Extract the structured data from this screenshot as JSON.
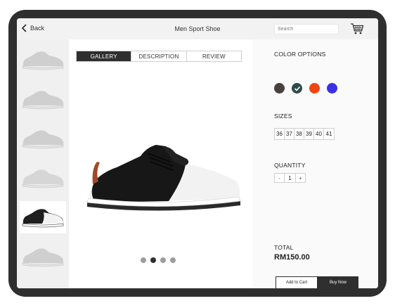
{
  "topbar": {
    "back_label": "Back",
    "title": "Men Sport Shoe",
    "search_placeholder": "Search"
  },
  "tabs": [
    {
      "label": "GALLERY",
      "active": true
    },
    {
      "label": "DESCRIPTION",
      "active": false
    },
    {
      "label": "REVIEW",
      "active": false
    }
  ],
  "thumbnails": [
    {
      "shoe_color": "#cfcfcf",
      "active": false
    },
    {
      "shoe_color": "#cfcfcf",
      "active": false
    },
    {
      "shoe_color": "#cfcfcf",
      "active": false
    },
    {
      "shoe_color": "#d6d6d6",
      "active": false
    },
    {
      "shoe_color": "#1f1f1f",
      "active": true
    },
    {
      "shoe_color": "#cfcfcf",
      "active": false
    }
  ],
  "carousel": {
    "dot_count": 4,
    "active_index": 1
  },
  "options": {
    "color_label": "COLOR OPTIONS",
    "colors": [
      "#4a3f3f",
      "#2f4a4a",
      "#f04410",
      "#3a30e6"
    ],
    "selected_color_index": 1,
    "sizes_label": "SIZES",
    "sizes": [
      "36",
      "37",
      "38",
      "39",
      "40",
      "41"
    ],
    "quantity_label": "QUANTITY",
    "qty_minus": "-",
    "qty_value": "1",
    "qty_plus": "+",
    "total_label": "TOTAL",
    "total_value": "RM150.00",
    "add_to_cart": "Add to Cart",
    "buy_now": "Buy Now"
  }
}
